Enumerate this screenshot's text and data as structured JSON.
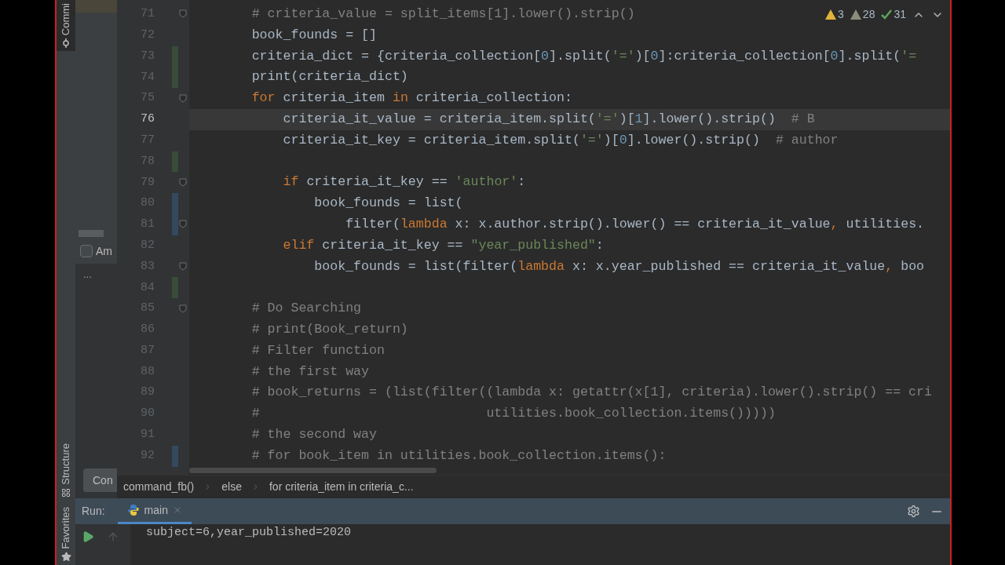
{
  "tool_strip": {
    "top": [
      {
        "label": "Commi",
        "selected": true
      }
    ],
    "bottom": [
      {
        "label": "Structure",
        "kind": "structure"
      },
      {
        "label": "Favorites",
        "kind": "star"
      }
    ]
  },
  "side_panel": {
    "checkbox": {
      "label": "Am",
      "checked": false
    },
    "ellipsis": "...",
    "button": "Con"
  },
  "inspections": [
    {
      "kind": "warning",
      "count": "3"
    },
    {
      "kind": "weak",
      "count": "28"
    },
    {
      "kind": "typo",
      "count": "31"
    }
  ],
  "editor": {
    "lines": [
      {
        "number": "71",
        "added": false,
        "modified": false,
        "fold": true,
        "current": false,
        "tokens": [
          {
            "kind": "comment",
            "text": "        # criteria_value = split_items[1].lower().strip()"
          }
        ]
      },
      {
        "number": "72",
        "added": false,
        "modified": false,
        "fold": false,
        "current": false,
        "tokens": [
          {
            "kind": "code",
            "text": "        book_founds = []"
          }
        ]
      },
      {
        "number": "73",
        "added": true,
        "modified": false,
        "fold": false,
        "current": false,
        "tokens": [
          {
            "kind": "code",
            "text": "        criteria_dict = {criteria_collection["
          },
          {
            "kind": "num",
            "text": "0"
          },
          {
            "kind": "code",
            "text": "].split("
          },
          {
            "kind": "str",
            "text": "'='"
          },
          {
            "kind": "code",
            "text": ")["
          },
          {
            "kind": "num",
            "text": "0"
          },
          {
            "kind": "code",
            "text": "]:criteria_collection["
          },
          {
            "kind": "num",
            "text": "0"
          },
          {
            "kind": "code",
            "text": "].split("
          },
          {
            "kind": "str",
            "text": "'="
          }
        ]
      },
      {
        "number": "74",
        "added": true,
        "modified": false,
        "fold": false,
        "current": false,
        "tokens": [
          {
            "kind": "code",
            "text": "        print(criteria_dict)"
          }
        ]
      },
      {
        "number": "75",
        "added": false,
        "modified": false,
        "fold": true,
        "current": false,
        "tokens": [
          {
            "kind": "kw",
            "text": "        for"
          },
          {
            "kind": "code",
            "text": " criteria_item "
          },
          {
            "kind": "kw",
            "text": "in"
          },
          {
            "kind": "code",
            "text": " criteria_collection:"
          }
        ]
      },
      {
        "number": "76",
        "added": false,
        "modified": false,
        "fold": false,
        "current": true,
        "tokens": [
          {
            "kind": "code",
            "text": "            criteria_it_value = criteria_item.split("
          },
          {
            "kind": "str",
            "text": "'='"
          },
          {
            "kind": "code",
            "text": ")["
          },
          {
            "kind": "num",
            "text": "1"
          },
          {
            "kind": "code",
            "text": "].lower().strip()  "
          },
          {
            "kind": "comment",
            "text": "# B"
          }
        ]
      },
      {
        "number": "77",
        "added": false,
        "modified": false,
        "fold": false,
        "current": false,
        "tokens": [
          {
            "kind": "code",
            "text": "            criteria_it_key = criteria_item.split("
          },
          {
            "kind": "str",
            "text": "'='"
          },
          {
            "kind": "code",
            "text": ")["
          },
          {
            "kind": "num",
            "text": "0"
          },
          {
            "kind": "code",
            "text": "].lower().strip()  "
          },
          {
            "kind": "comment",
            "text": "# author"
          }
        ]
      },
      {
        "number": "78",
        "added": true,
        "modified": false,
        "fold": false,
        "current": false
      },
      {
        "number": "79",
        "added": false,
        "modified": false,
        "fold": true,
        "current": false,
        "tokens": [
          {
            "kind": "kw",
            "text": "            if"
          },
          {
            "kind": "code",
            "text": " criteria_it_key == "
          },
          {
            "kind": "str",
            "text": "'author'"
          },
          {
            "kind": "code",
            "text": ":"
          }
        ]
      },
      {
        "number": "80",
        "added": false,
        "modified": true,
        "fold": false,
        "current": false,
        "tokens": [
          {
            "kind": "code",
            "text": "                book_founds = list("
          }
        ]
      },
      {
        "number": "81",
        "added": false,
        "modified": true,
        "fold": true,
        "current": false,
        "tokens": [
          {
            "kind": "code",
            "text": "                    filter("
          },
          {
            "kind": "kw",
            "text": "lambda"
          },
          {
            "kind": "code",
            "text": " x: x.author.strip().lower() == criteria_it_value"
          },
          {
            "kind": "kw",
            "text": ","
          },
          {
            "kind": "code",
            "text": " utilities."
          }
        ]
      },
      {
        "number": "82",
        "added": false,
        "modified": false,
        "fold": false,
        "current": false,
        "tokens": [
          {
            "kind": "kw",
            "text": "            elif"
          },
          {
            "kind": "code",
            "text": " criteria_it_key == "
          },
          {
            "kind": "str",
            "text": "\"year_published\""
          },
          {
            "kind": "code",
            "text": ":"
          }
        ]
      },
      {
        "number": "83",
        "added": false,
        "modified": false,
        "fold": true,
        "current": false,
        "tokens": [
          {
            "kind": "code",
            "text": "                book_founds = list(filter("
          },
          {
            "kind": "kw",
            "text": "lambda"
          },
          {
            "kind": "code",
            "text": " x: x.year_published == criteria_it_value"
          },
          {
            "kind": "kw",
            "text": ","
          },
          {
            "kind": "code",
            "text": " boo"
          }
        ]
      },
      {
        "number": "84",
        "added": true,
        "modified": false,
        "fold": false,
        "current": false
      },
      {
        "number": "85",
        "added": false,
        "modified": false,
        "fold": true,
        "current": false,
        "tokens": [
          {
            "kind": "comment",
            "text": "        # Do Searching"
          }
        ]
      },
      {
        "number": "86",
        "added": false,
        "modified": false,
        "fold": false,
        "current": false,
        "tokens": [
          {
            "kind": "comment",
            "text": "        # print(Book_return)"
          }
        ]
      },
      {
        "number": "87",
        "added": false,
        "modified": false,
        "fold": false,
        "current": false,
        "tokens": [
          {
            "kind": "comment",
            "text": "        # Filter function"
          }
        ]
      },
      {
        "number": "88",
        "added": false,
        "modified": false,
        "fold": false,
        "current": false,
        "tokens": [
          {
            "kind": "comment",
            "text": "        # the first way"
          }
        ]
      },
      {
        "number": "89",
        "added": false,
        "modified": false,
        "fold": false,
        "current": false,
        "tokens": [
          {
            "kind": "comment",
            "text": "        # book_returns = (list(filter((lambda x: getattr(x[1], criteria).lower().strip() == cri"
          }
        ]
      },
      {
        "number": "90",
        "added": false,
        "modified": false,
        "fold": false,
        "current": false,
        "tokens": [
          {
            "kind": "comment",
            "text": "        #                             utilities.book_collection.items()))))"
          }
        ]
      },
      {
        "number": "91",
        "added": false,
        "modified": false,
        "fold": false,
        "current": false,
        "tokens": [
          {
            "kind": "comment",
            "text": "        # the second way"
          }
        ]
      },
      {
        "number": "92",
        "added": false,
        "modified": true,
        "fold": false,
        "current": false,
        "tokens": [
          {
            "kind": "comment",
            "text": "        # for book_item in utilities.book_collection.items():"
          }
        ]
      }
    ]
  },
  "breadcrumbs": [
    "command_fb()",
    "else",
    "for criteria_item in criteria_c..."
  ],
  "run": {
    "label": "Run:",
    "tabs": [
      {
        "label": "main",
        "selected": true
      }
    ],
    "output": [
      "subject=6,year_published=2020"
    ]
  }
}
